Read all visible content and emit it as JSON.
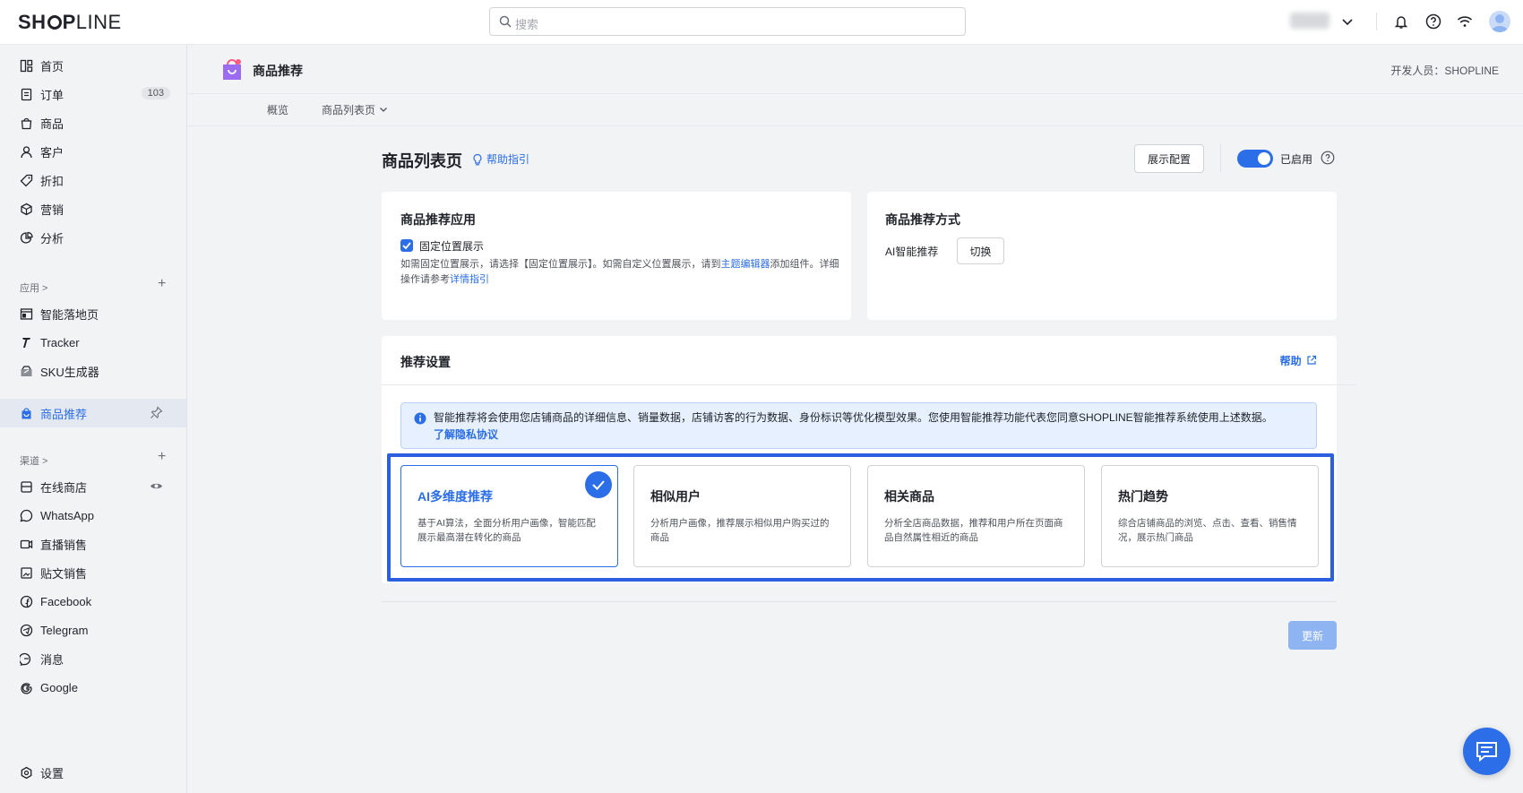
{
  "topbar": {
    "search_placeholder": "搜索"
  },
  "sidebar": {
    "items": [
      {
        "label": "首页",
        "icon": "dashboard-icon"
      },
      {
        "label": "订单",
        "icon": "order-icon",
        "badge": "103"
      },
      {
        "label": "商品",
        "icon": "bag-icon"
      },
      {
        "label": "客户",
        "icon": "user-icon"
      },
      {
        "label": "折扣",
        "icon": "tag-icon"
      },
      {
        "label": "营销",
        "icon": "marketing-icon"
      },
      {
        "label": "分析",
        "icon": "analytics-icon"
      }
    ],
    "apps_label": "应用 >",
    "apps": [
      {
        "label": "智能落地页",
        "icon": "landing-page-icon"
      },
      {
        "label": "Tracker",
        "icon": "tracker-icon"
      },
      {
        "label": "SKU生成器",
        "icon": "sku-icon"
      }
    ],
    "active_app": "商品推荐",
    "channels_label": "渠道 >",
    "channels": [
      {
        "label": "在线商店",
        "icon": "store-icon"
      },
      {
        "label": "WhatsApp",
        "icon": "whatsapp-icon"
      },
      {
        "label": "直播销售",
        "icon": "live-icon"
      },
      {
        "label": "贴文销售",
        "icon": "post-icon"
      },
      {
        "label": "Facebook",
        "icon": "facebook-icon"
      },
      {
        "label": "Telegram",
        "icon": "telegram-icon"
      },
      {
        "label": "消息",
        "icon": "message-icon"
      },
      {
        "label": "Google",
        "icon": "google-icon"
      }
    ],
    "settings": "设置"
  },
  "app_header": {
    "title": "商品推荐",
    "developer": "开发人员：SHOPLINE"
  },
  "subnav": {
    "tab_overview": "概览",
    "tab_list": "商品列表页"
  },
  "page": {
    "title": "商品列表页",
    "help_guide": "帮助指引",
    "display_config": "展示配置",
    "enabled_label": "已启用"
  },
  "app_card": {
    "title": "商品推荐应用",
    "checkbox_label": "固定位置展示",
    "desc_a": "如需固定位置展示，请选择【固定位置展示】。如需自定义位置展示，请到",
    "desc_link": "主题编辑器",
    "desc_b": "添加组件。详细",
    "desc_c": "操作请参考",
    "desc_link2": "详情指引"
  },
  "method_card": {
    "title": "商品推荐方式",
    "method_label": "AI智能推荐",
    "switch_button": "切换"
  },
  "settings_card": {
    "title": "推荐设置",
    "help": "帮助",
    "notice": "智能推荐将会使用您店铺商品的详细信息、销量数据，店铺访客的行为数据、身份标识等优化模型效果。您使用智能推荐功能代表您同意SHOPLINE智能推荐系统使用上述数据。",
    "notice_link": "了解隐私协议",
    "options": [
      {
        "title": "AI多维度推荐",
        "desc": "基于AI算法，全面分析用户画像，智能匹配展示最高潜在转化的商品"
      },
      {
        "title": "相似用户",
        "desc": "分析用户画像，推荐展示相似用户购买过的商品"
      },
      {
        "title": "相关商品",
        "desc": "分析全店商品数据，推荐和用户所在页面商品自然属性相近的商品"
      },
      {
        "title": "热门趋势",
        "desc": "综合店铺商品的浏览、点击、查看、销售情况，展示热门商品"
      }
    ],
    "selected_option": "AI多维度推荐"
  },
  "update_button": "更新",
  "colors": {
    "accent": "#2b6ee7",
    "highlight_border": "#2b5fe0"
  }
}
